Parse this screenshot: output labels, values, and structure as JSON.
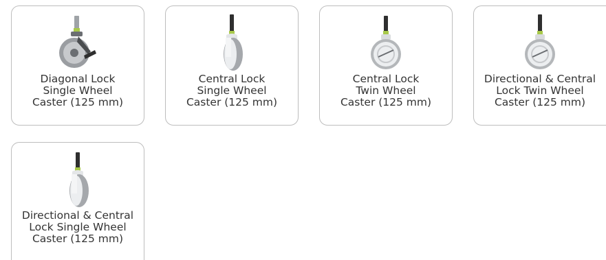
{
  "products": [
    {
      "label": "Diagonal Lock\nSingle Wheel\nCaster (125 mm)",
      "icon": "diagonal-lock-single-wheel-caster-icon"
    },
    {
      "label": "Central Lock\nSingle Wheel\nCaster (125 mm)",
      "icon": "central-lock-single-wheel-caster-icon"
    },
    {
      "label": "Central Lock\nTwin Wheel\nCaster (125 mm)",
      "icon": "central-lock-twin-wheel-caster-icon"
    },
    {
      "label": "Directional & Central\nLock Twin Wheel\nCaster (125 mm)",
      "icon": "directional-central-lock-twin-wheel-caster-icon"
    },
    {
      "label": "Directional & Central\nLock Single Wheel\nCaster (125 mm)",
      "icon": "directional-central-lock-single-wheel-caster-icon"
    }
  ],
  "colors": {
    "stem_green": "#a8c94a",
    "stem_dark": "#2f2f2f",
    "wheel_grey": "#a5a8ac",
    "hub_light": "#e4e6e8",
    "card_border": "#bdbdbd",
    "text": "#333333"
  }
}
